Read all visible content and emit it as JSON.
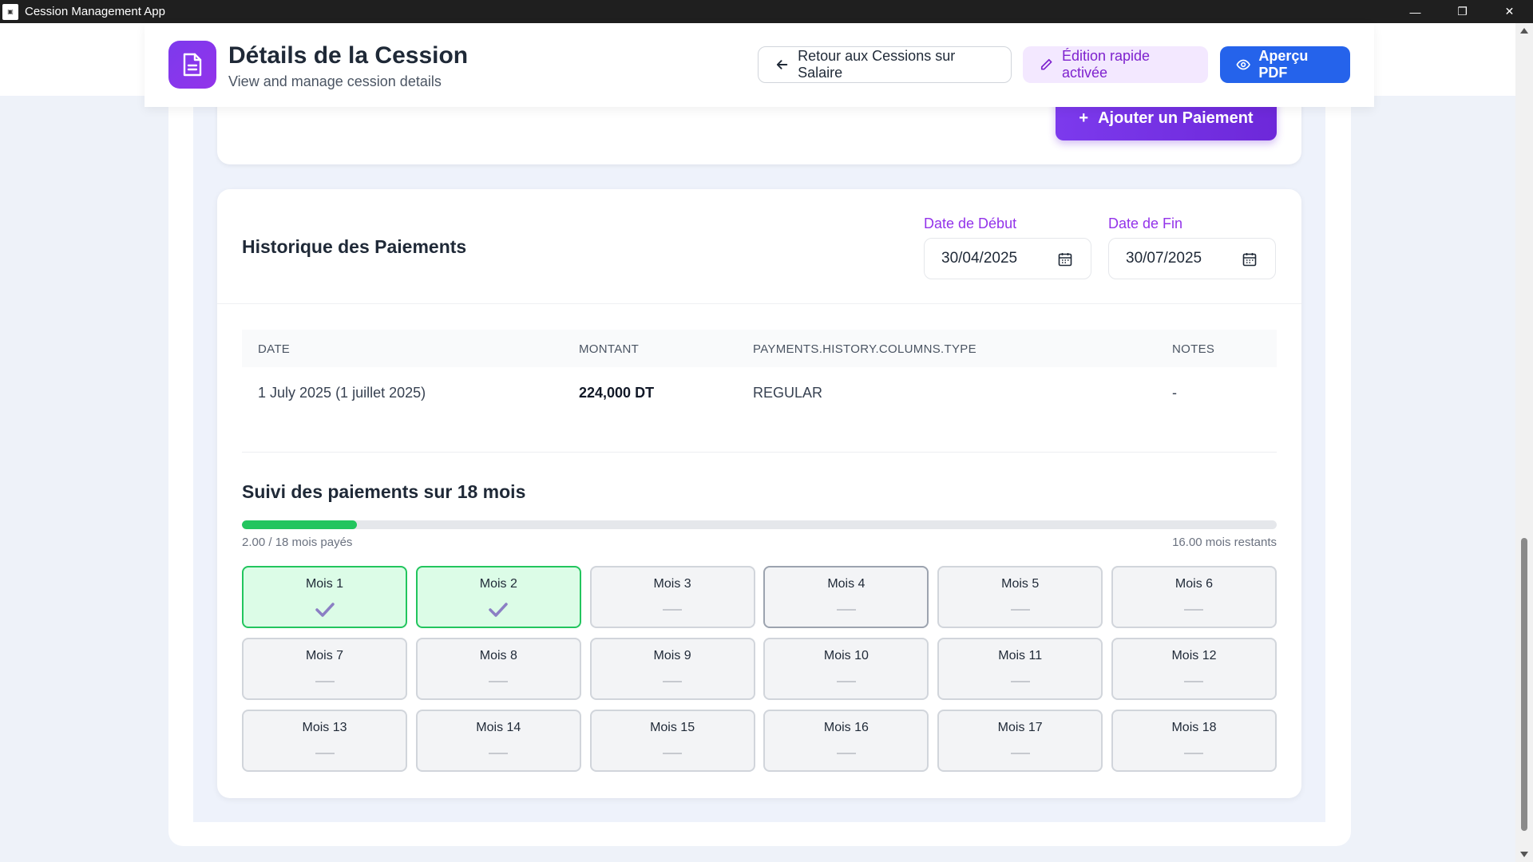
{
  "window": {
    "title": "Cession Management App",
    "controls": [
      "—",
      "❐",
      "✕"
    ]
  },
  "header": {
    "title": "Détails de la Cession",
    "subtitle": "View and manage cession details",
    "back_label": "Retour aux Cessions sur Salaire",
    "quick_edit_label": "Édition rapide activée",
    "pdf_label": "Aperçu PDF"
  },
  "actions": {
    "add_payment_label": "Ajouter un Paiement"
  },
  "history": {
    "title": "Historique des Paiements",
    "start_label": "Date de Début",
    "start_value": "30/04/2025",
    "end_label": "Date de Fin",
    "end_value": "30/07/2025",
    "columns": [
      "DATE",
      "MONTANT",
      "PAYMENTS.HISTORY.COLUMNS.TYPE",
      "NOTES"
    ],
    "rows": [
      {
        "date": "1 July 2025 (1 juillet 2025)",
        "amount": "224,000 DT",
        "type": "REGULAR",
        "notes": "-"
      }
    ]
  },
  "tracking": {
    "title": "Suivi des paiements sur 18 mois",
    "paid_text": "2.00 / 18 mois payés",
    "remaining_text": "16.00 mois restants",
    "paid_fraction": 0.111,
    "months": [
      {
        "label": "Mois 1",
        "status": "paid"
      },
      {
        "label": "Mois 2",
        "status": "paid"
      },
      {
        "label": "Mois 3",
        "status": "unpaid"
      },
      {
        "label": "Mois 4",
        "status": "current"
      },
      {
        "label": "Mois 5",
        "status": "unpaid"
      },
      {
        "label": "Mois 6",
        "status": "unpaid"
      },
      {
        "label": "Mois 7",
        "status": "unpaid"
      },
      {
        "label": "Mois 8",
        "status": "unpaid"
      },
      {
        "label": "Mois 9",
        "status": "unpaid"
      },
      {
        "label": "Mois 10",
        "status": "unpaid"
      },
      {
        "label": "Mois 11",
        "status": "unpaid"
      },
      {
        "label": "Mois 12",
        "status": "unpaid"
      },
      {
        "label": "Mois 13",
        "status": "unpaid"
      },
      {
        "label": "Mois 14",
        "status": "unpaid"
      },
      {
        "label": "Mois 15",
        "status": "unpaid"
      },
      {
        "label": "Mois 16",
        "status": "unpaid"
      },
      {
        "label": "Mois 17",
        "status": "unpaid"
      },
      {
        "label": "Mois 18",
        "status": "unpaid"
      }
    ]
  },
  "colors": {
    "brand_purple": "#7c3aed",
    "pdf_blue": "#2563eb",
    "paid_green": "#22c55e",
    "paid_bg": "#dcfce7"
  }
}
